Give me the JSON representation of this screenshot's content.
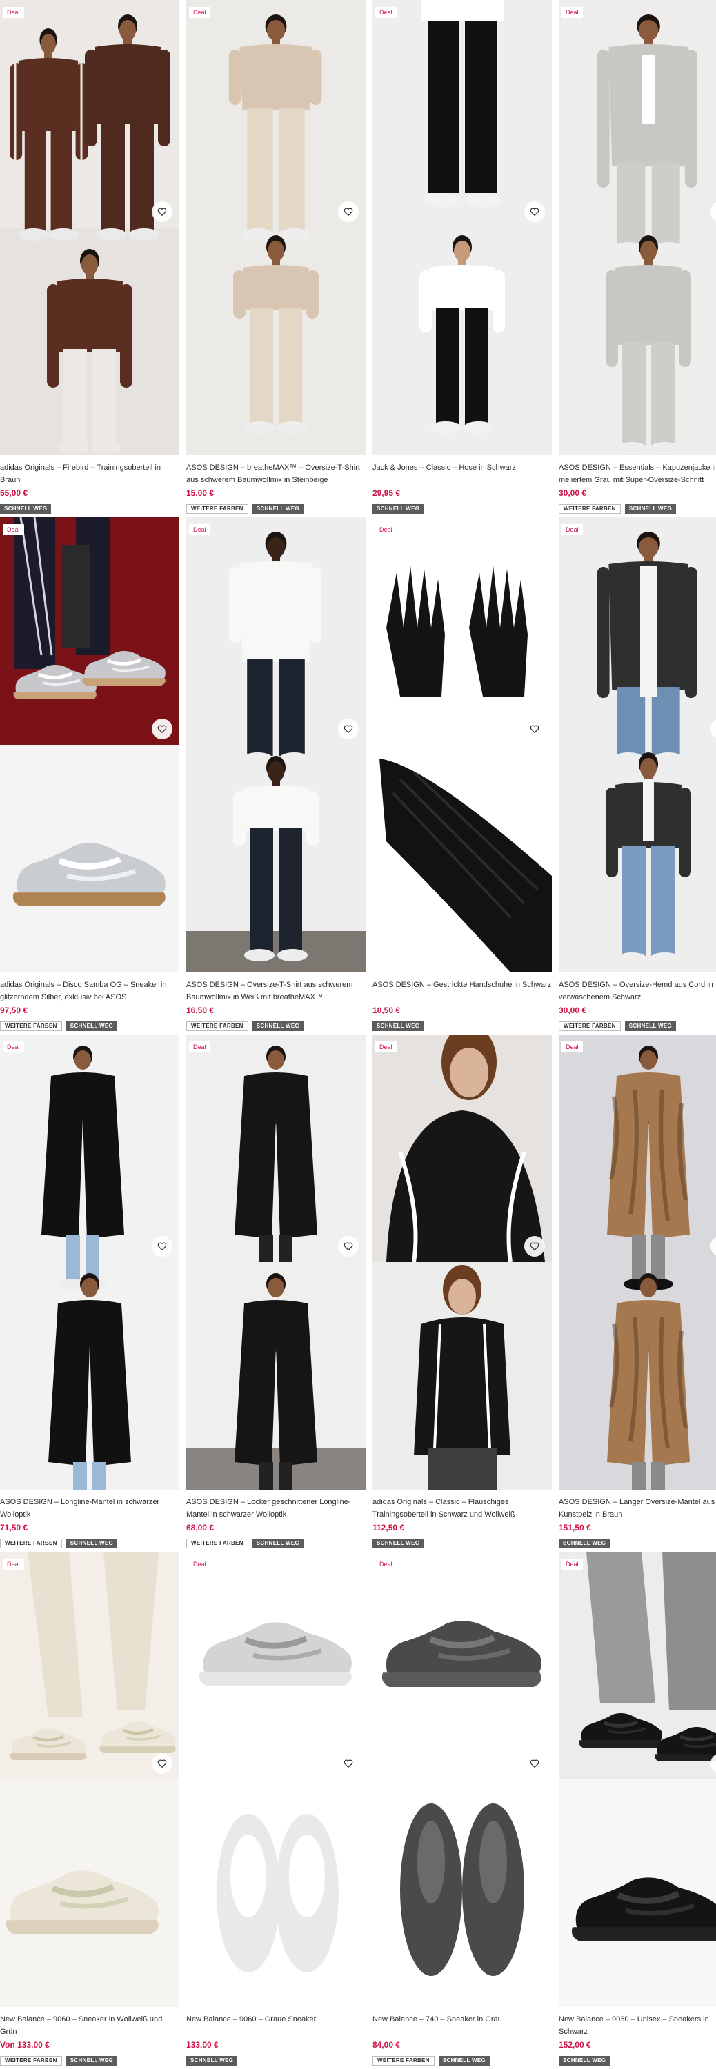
{
  "labels": {
    "deal": "Deal",
    "more_colors": "WEITERE FARBEN",
    "quick_view": "SCHNELL WEG",
    "price_from_prefix": "Von "
  },
  "icons": {
    "wishlist": "heart-outline-icon"
  },
  "colors": {
    "price": "#d01345",
    "deal_text": "#d01345",
    "quick_badge_bg": "#5c5c5c"
  },
  "products": [
    {
      "name": "adidas Originals – Firebird – Trainingsoberteil in Braun",
      "price": "55,00 €",
      "deal": true,
      "more_colors": false,
      "quick": true
    },
    {
      "name": "ASOS DESIGN – breatheMAX™ – Oversize-T-Shirt aus schwerem Baumwollmix in Steinbeige",
      "price": "15,00 €",
      "deal": true,
      "more_colors": true,
      "quick": true
    },
    {
      "name": "Jack & Jones – Classic – Hose in Schwarz",
      "price": "29,95 €",
      "deal": true,
      "more_colors": false,
      "quick": true
    },
    {
      "name": "ASOS DESIGN – Essentials – Kapuzenjacke in meliertem Grau mit Super-Oversize-Schnitt",
      "price": "30,00 €",
      "deal": true,
      "more_colors": true,
      "quick": true
    },
    {
      "name": "adidas Originals – Disco Samba OG – Sneaker in glitzerndem Silber, exklusiv bei ASOS",
      "price": "97,50 €",
      "deal": true,
      "more_colors": true,
      "quick": true
    },
    {
      "name": "ASOS DESIGN – Oversize-T-Shirt aus schwerem Baumwollmix in Weiß mit breatheMAX™...",
      "price": "16,50 €",
      "deal": true,
      "more_colors": true,
      "quick": true
    },
    {
      "name": "ASOS DESIGN – Gestrickte Handschuhe in Schwarz",
      "price": "10,50 €",
      "deal": true,
      "more_colors": false,
      "quick": true
    },
    {
      "name": "ASOS DESIGN – Oversize-Hemd aus Cord in verwaschenem Schwarz",
      "price": "30,00 €",
      "deal": true,
      "more_colors": true,
      "quick": true
    },
    {
      "name": "ASOS DESIGN – Longline-Mantel in schwarzer Wolloptik",
      "price": "71,50 €",
      "deal": true,
      "more_colors": true,
      "quick": true
    },
    {
      "name": "ASOS DESIGN – Locker geschnittener Longline-Mantel in schwarzer Wolloptik",
      "price": "68,00 €",
      "deal": true,
      "more_colors": true,
      "quick": true
    },
    {
      "name": "adidas Originals – Classic – Flauschiges Trainingsoberteil in Schwarz und Wollweiß",
      "price": "112,50 €",
      "deal": true,
      "more_colors": false,
      "quick": true
    },
    {
      "name": "ASOS DESIGN – Langer Oversize-Mantel aus Kunstpelz in Braun",
      "price": "151,50 €",
      "deal": true,
      "more_colors": false,
      "quick": true
    },
    {
      "name": "New Balance – 9060 – Sneaker in Wollweiß und Grün",
      "price": "133,00 €",
      "price_prefix": true,
      "deal": true,
      "more_colors": true,
      "quick": true
    },
    {
      "name": "New Balance – 9060 – Graue Sneaker",
      "price": "133,00 €",
      "deal": true,
      "more_colors": false,
      "quick": true
    },
    {
      "name": "New Balance – 740 – Sneaker in Grau",
      "price": "84,00 €",
      "deal": true,
      "more_colors": true,
      "quick": true
    },
    {
      "name": "New Balance – 9060 – Unisex – Sneakers in Schwarz",
      "price": "152,00 €",
      "deal": true,
      "more_colors": false,
      "quick": true
    }
  ]
}
